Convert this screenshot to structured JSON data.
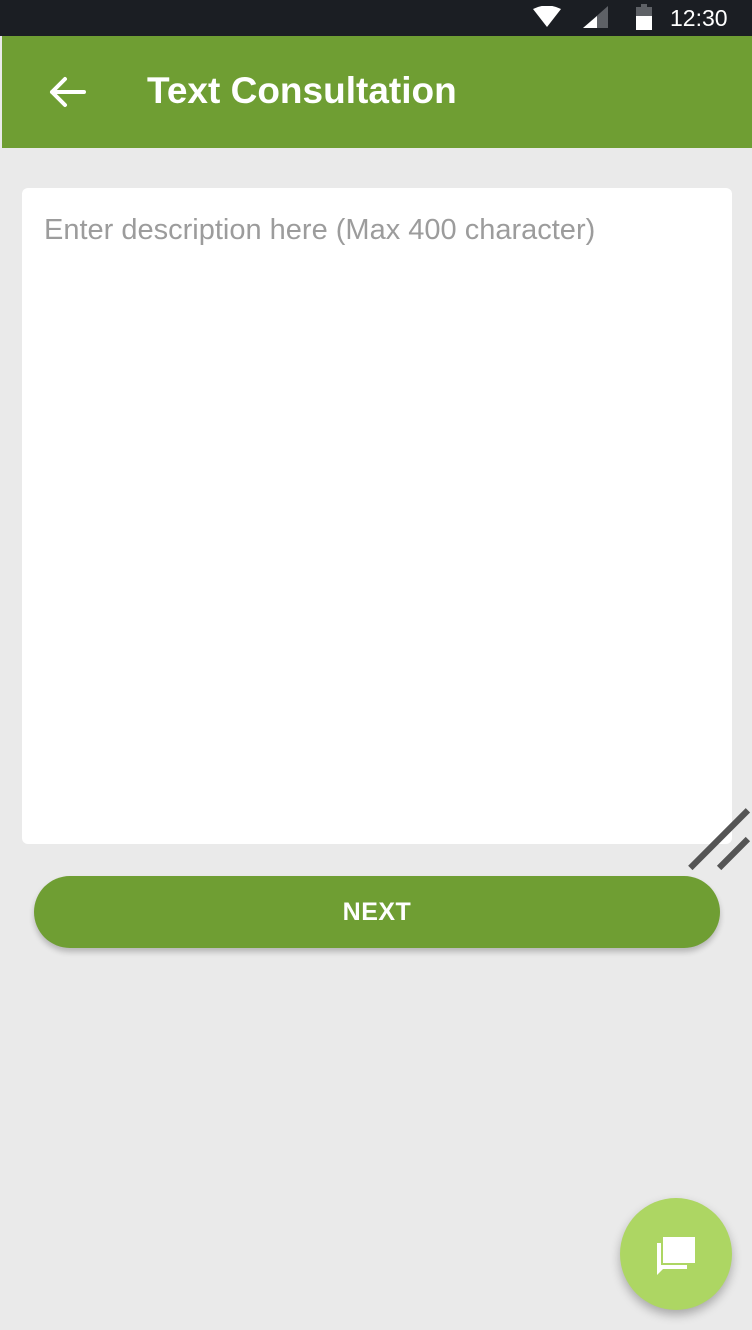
{
  "status_bar": {
    "time": "12:30",
    "icons": [
      "wifi-icon",
      "signal-icon",
      "battery-icon"
    ]
  },
  "app_bar": {
    "back_icon": "arrow-left-icon",
    "title": "Text Consultation"
  },
  "description": {
    "placeholder": "Enter description here (Max 400 character)",
    "value": ""
  },
  "next_button": {
    "label": "NEXT"
  },
  "fab": {
    "icon": "chat-icon"
  },
  "colors": {
    "primary": "#6f9e33",
    "fab": "#add663",
    "background": "#eaeaea",
    "status_bar": "#1b1e23"
  }
}
